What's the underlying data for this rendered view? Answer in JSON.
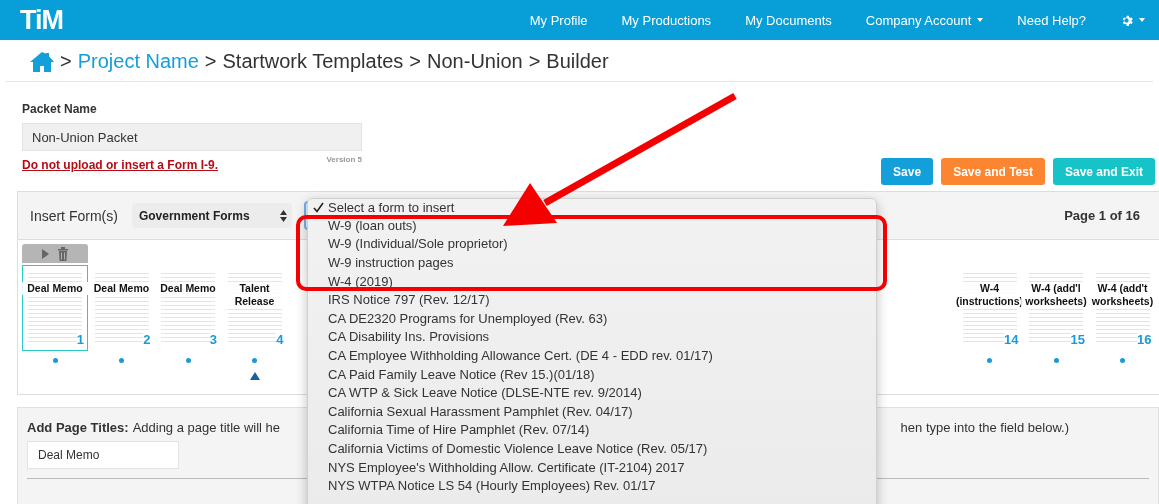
{
  "nav": {
    "logo": "TiM",
    "items": [
      {
        "label": "My Profile",
        "dropdown": false
      },
      {
        "label": "My Productions",
        "dropdown": false
      },
      {
        "label": "My Documents",
        "dropdown": false
      },
      {
        "label": "Company Account",
        "dropdown": true
      },
      {
        "label": "Need Help?",
        "dropdown": false
      }
    ]
  },
  "breadcrumb": {
    "separator": ">",
    "items": [
      {
        "label": "Project Name",
        "link": true
      },
      {
        "label": "Startwork Templates",
        "link": false
      },
      {
        "label": "Non-Union",
        "link": false
      },
      {
        "label": "Builder",
        "link": false
      }
    ]
  },
  "packet": {
    "label": "Packet Name",
    "value": "Non-Union Packet",
    "warning": "Do not upload or insert a Form I-9.",
    "version": "Version 5"
  },
  "actions": [
    {
      "label": "Save",
      "color": "#139fd9"
    },
    {
      "label": "Save and Test",
      "color": "#fb8531"
    },
    {
      "label": "Save and Exit",
      "color": "#16c3c7"
    }
  ],
  "insert_panel": {
    "label": "Insert Form(s)",
    "category": "Government Forms",
    "page_indicator": "Page 1 of 16",
    "thumbnails_left": [
      {
        "title": "Deal Memo",
        "number": "1",
        "selected": true,
        "insert_marker": false
      },
      {
        "title": "Deal Memo",
        "number": "2",
        "selected": false,
        "insert_marker": false
      },
      {
        "title": "Deal Memo",
        "number": "3",
        "selected": false,
        "insert_marker": false
      },
      {
        "title": "Talent Release",
        "number": "4",
        "selected": false,
        "insert_marker": true
      }
    ],
    "thumbnails_right": [
      {
        "title": "W-4 (instructions)",
        "number": "14",
        "selected": false,
        "insert_marker": false
      },
      {
        "title": "W-4 (add'l worksheets)",
        "number": "15",
        "selected": false,
        "insert_marker": false
      },
      {
        "title": "W-4 (add't worksheets)",
        "number": "16",
        "selected": false,
        "insert_marker": false
      }
    ]
  },
  "form_menu": {
    "items": [
      {
        "label": "Select a form to insert",
        "checked": true
      },
      {
        "label": "W-9 (loan outs)",
        "checked": false
      },
      {
        "label": "W-9 (Individual/Sole proprietor)",
        "checked": false
      },
      {
        "label": "W-9 instruction pages",
        "checked": false
      },
      {
        "label": "W-4 (2019)",
        "checked": false
      },
      {
        "label": "IRS Notice 797 (Rev. 12/17)",
        "checked": false
      },
      {
        "label": "CA DE2320 Programs for Unemployed (Rev. 63)",
        "checked": false
      },
      {
        "label": "CA Disability Ins. Provisions",
        "checked": false
      },
      {
        "label": "CA Employee Withholding Allowance Cert. (DE 4 - EDD rev. 01/17)",
        "checked": false
      },
      {
        "label": "CA Paid Family Leave Notice (Rev 15.)(01/18)",
        "checked": false
      },
      {
        "label": "CA WTP & Sick Leave Notice (DLSE-NTE rev. 9/2014)",
        "checked": false
      },
      {
        "label": "California Sexual Harassment Pamphlet (Rev. 04/17)",
        "checked": false
      },
      {
        "label": "California Time of Hire Pamphlet (Rev. 07/14)",
        "checked": false
      },
      {
        "label": "California Victims of Domestic Violence Leave Notice (Rev. 05/17)",
        "checked": false
      },
      {
        "label": "NYS Employee's Withholding Allow. Certificate (IT-2104) 2017",
        "checked": false
      },
      {
        "label": "NYS WTPA Notice LS 54 (Hourly Employees) Rev. 01/17",
        "checked": false
      }
    ]
  },
  "page_titles": {
    "label": "Add Page Titles:",
    "text_start": "Adding a page title will he",
    "text_end": "hen type into the field below.)",
    "value": "Deal Memo"
  }
}
